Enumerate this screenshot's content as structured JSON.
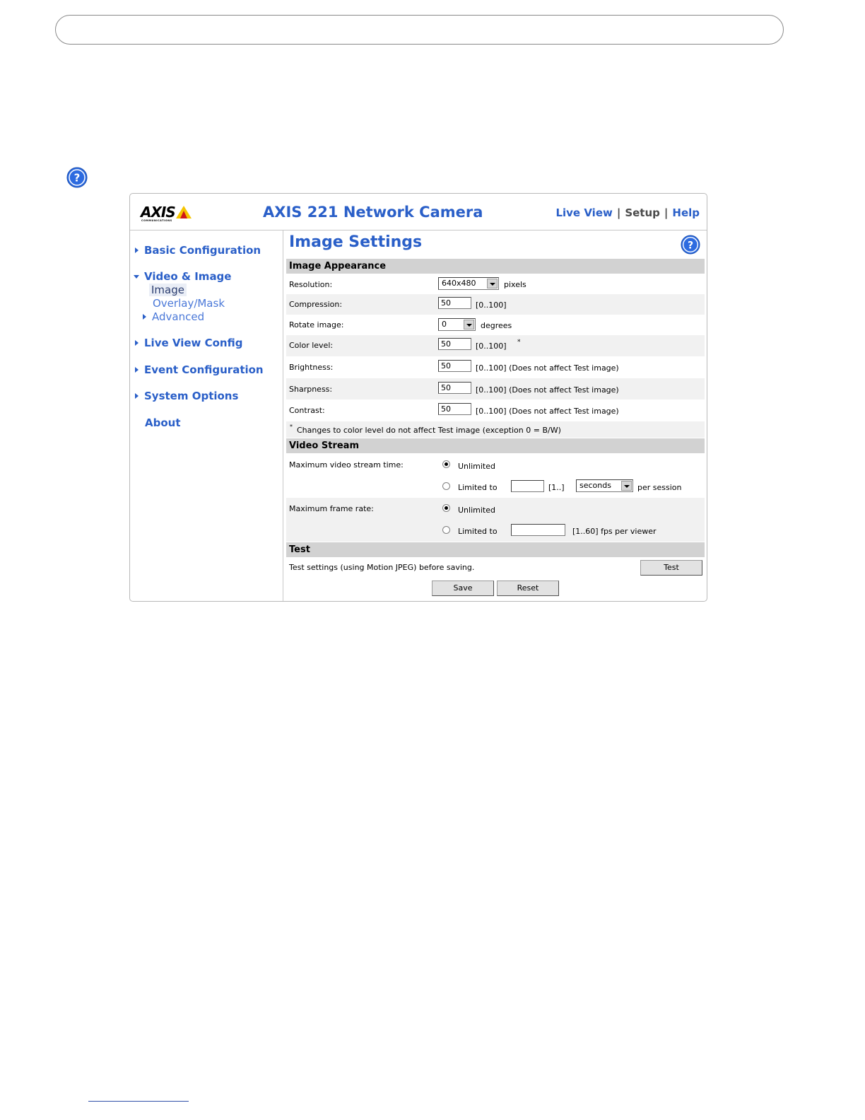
{
  "camera": {
    "logo": "AXIS",
    "logo_sub": "COMMUNICATIONS",
    "title": "AXIS 221 Network Camera",
    "nav": {
      "live_view": "Live View",
      "setup": "Setup",
      "help": "Help",
      "sep": "|"
    }
  },
  "sidebar": {
    "basic": "Basic Configuration",
    "video_image": "Video & Image",
    "image": "Image",
    "overlay": "Overlay/Mask",
    "advanced": "Advanced",
    "live_view_config": "Live View Config",
    "event_config": "Event Configuration",
    "system_options": "System Options",
    "about": "About"
  },
  "main": {
    "title": "Image Settings",
    "sections": {
      "appearance": "Image Appearance",
      "video_stream": "Video Stream",
      "test": "Test"
    },
    "fields": {
      "resolution": {
        "label": "Resolution:",
        "value": "640x480",
        "unit": "pixels"
      },
      "compression": {
        "label": "Compression:",
        "value": "50",
        "hint": "[0..100]"
      },
      "rotate": {
        "label": "Rotate image:",
        "value": "0",
        "unit": "degrees"
      },
      "color": {
        "label": "Color level:",
        "value": "50",
        "hint": "[0..100]",
        "mark": "*"
      },
      "brightness": {
        "label": "Brightness:",
        "value": "50",
        "hint": "[0..100] (Does not affect Test image)"
      },
      "sharpness": {
        "label": "Sharpness:",
        "value": "50",
        "hint": "[0..100] (Does not affect Test image)"
      },
      "contrast": {
        "label": "Contrast:",
        "value": "50",
        "hint": "[0..100] (Does not affect Test image)"
      },
      "note_mark": "*",
      "note": "Changes to color level do not affect Test image (exception 0 = B/W)"
    },
    "stream": {
      "max_time_label": "Maximum video stream time:",
      "unlimited": "Unlimited",
      "limited_to": "Limited to",
      "time_range": "[1..]",
      "time_unit": "seconds",
      "per_session": "per session",
      "max_fps_label": "Maximum frame rate:",
      "fps_range": "[1..60] fps per viewer"
    },
    "test": {
      "text": "Test settings (using Motion JPEG) before saving.",
      "test_button": "Test",
      "save_button": "Save",
      "reset_button": "Reset"
    }
  }
}
